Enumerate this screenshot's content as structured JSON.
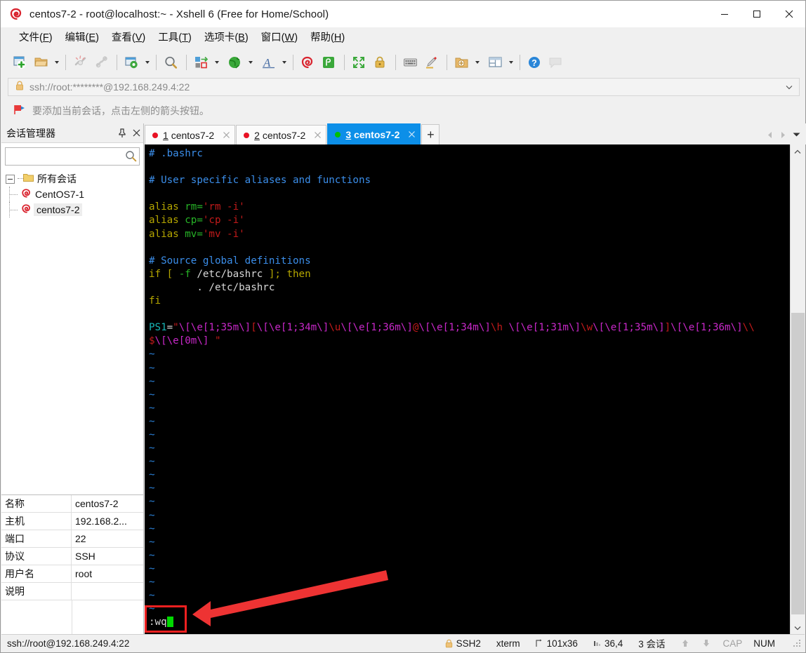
{
  "window": {
    "title": "centos7-2 - root@localhost:~ - Xshell 6 (Free for Home/School)",
    "app_icon": "xshell-logo-icon",
    "minimize_label": "—",
    "maximize_label": "☐",
    "close_label": "✕"
  },
  "menubar": {
    "items": [
      {
        "name": "file",
        "text": "文件",
        "accel": "F"
      },
      {
        "name": "edit",
        "text": "编辑",
        "accel": "E"
      },
      {
        "name": "view",
        "text": "查看",
        "accel": "V"
      },
      {
        "name": "tools",
        "text": "工具",
        "accel": "T"
      },
      {
        "name": "tabs",
        "text": "选项卡",
        "accel": "B"
      },
      {
        "name": "window",
        "text": "窗口",
        "accel": "W"
      },
      {
        "name": "help",
        "text": "帮助",
        "accel": "H"
      }
    ]
  },
  "toolbar": {
    "icons": [
      "new-session-icon",
      "open-folder-icon",
      "disconnect-icon",
      "connect-icon",
      "session-properties-icon",
      "find-icon",
      "transfer-file-icon",
      "web-browser-icon",
      "font-icon",
      "xshell-icon",
      "xftp-icon",
      "fullscreen-icon",
      "lock-icon",
      "keyboard-icon",
      "highlight-icon",
      "add-folder-icon",
      "layout-icon",
      "help-icon",
      "chat-icon"
    ]
  },
  "address_bar": {
    "lock_icon": "lock-icon",
    "value": "ssh://root:********@192.168.249.4:22",
    "placeholder": "ssh://root:********@192.168.249.4:22",
    "dropdown_icon": "chevron-down-icon"
  },
  "notice_bar": {
    "icon": "red-flag-icon",
    "text": "要添加当前会话，点击左侧的箭头按钮。"
  },
  "session_manager": {
    "title": "会话管理器",
    "pin_icon": "pin-icon",
    "close_icon": "close-icon",
    "search": {
      "value": "",
      "placeholder": "",
      "icon": "search-icon"
    },
    "tree": {
      "root": {
        "label": "所有会话",
        "icon": "folder-icon",
        "expanded": true
      },
      "children": [
        {
          "label": "CentOS7-1",
          "icon": "session-icon",
          "selected": false
        },
        {
          "label": "centos7-2",
          "icon": "session-icon",
          "selected": true
        }
      ]
    },
    "properties": {
      "rows": [
        {
          "key": "名称",
          "value": "centos7-2"
        },
        {
          "key": "主机",
          "value": "192.168.2..."
        },
        {
          "key": "端口",
          "value": "22"
        },
        {
          "key": "协议",
          "value": "SSH"
        },
        {
          "key": "用户名",
          "value": "root"
        },
        {
          "key": "说明",
          "value": ""
        }
      ]
    }
  },
  "tabs": {
    "items": [
      {
        "index": "1",
        "label": "centos7-2",
        "status_color": "#e81123",
        "active": false,
        "close_icon": "close-icon"
      },
      {
        "index": "2",
        "label": "centos7-2",
        "status_color": "#e81123",
        "active": false,
        "close_icon": "close-icon"
      },
      {
        "index": "3",
        "label": "centos7-2",
        "status_color": "#00c000",
        "active": true,
        "close_icon": "close-icon"
      }
    ],
    "add_label": "+",
    "prev_icon": "chevron-left-icon",
    "next_icon": "chevron-right-icon",
    "list_icon": "chevron-down-icon",
    "active_color": "#0c8fe8"
  },
  "terminal": {
    "background": "#000000",
    "lines": [
      [
        {
          "t": "# .bashrc",
          "c": "comment"
        }
      ],
      [],
      [
        {
          "t": "# User specific aliases and functions",
          "c": "comment"
        }
      ],
      [],
      [
        {
          "t": "alias ",
          "c": "kw"
        },
        {
          "t": "rm=",
          "c": "green"
        },
        {
          "t": "'rm -i'",
          "c": "red"
        }
      ],
      [
        {
          "t": "alias ",
          "c": "kw"
        },
        {
          "t": "cp=",
          "c": "green"
        },
        {
          "t": "'cp -i'",
          "c": "red"
        }
      ],
      [
        {
          "t": "alias ",
          "c": "kw"
        },
        {
          "t": "mv=",
          "c": "green"
        },
        {
          "t": "'mv -i'",
          "c": "red"
        }
      ],
      [],
      [
        {
          "t": "# Source global definitions",
          "c": "comment"
        }
      ],
      [
        {
          "t": "if ",
          "c": "kw"
        },
        {
          "t": "[ ",
          "c": "kw"
        },
        {
          "t": "-f ",
          "c": "green"
        },
        {
          "t": "/etc/bashrc ",
          "c": "white"
        },
        {
          "t": "]; ",
          "c": "kw"
        },
        {
          "t": "then",
          "c": "kw"
        }
      ],
      [
        {
          "t": "        . /etc/bashrc",
          "c": "white"
        }
      ],
      [
        {
          "t": "fi",
          "c": "kw"
        }
      ],
      [],
      [
        {
          "t": "PS1",
          "c": "teal"
        },
        {
          "t": "=",
          "c": "white"
        },
        {
          "t": "\"",
          "c": "red"
        },
        {
          "t": "\\[\\e[1;35m\\]",
          "c": "magenta"
        },
        {
          "t": "[",
          "c": "red"
        },
        {
          "t": "\\[\\e[1;34m\\]",
          "c": "magenta"
        },
        {
          "t": "\\u",
          "c": "red"
        },
        {
          "t": "\\[\\e[1;36m\\]",
          "c": "magenta"
        },
        {
          "t": "@",
          "c": "red"
        },
        {
          "t": "\\[\\e[1;34m\\]",
          "c": "magenta"
        },
        {
          "t": "\\h ",
          "c": "red"
        },
        {
          "t": "\\[\\e[1;31m\\]",
          "c": "magenta"
        },
        {
          "t": "\\w",
          "c": "red"
        },
        {
          "t": "\\[\\e[1;35m\\]",
          "c": "magenta"
        },
        {
          "t": "]",
          "c": "red"
        },
        {
          "t": "\\[\\e[1;36m\\]",
          "c": "magenta"
        },
        {
          "t": "\\\\",
          "c": "red"
        }
      ],
      [
        {
          "t": "$",
          "c": "red"
        },
        {
          "t": "\\[\\e[0m\\]",
          "c": "magenta"
        },
        {
          "t": " \"",
          "c": "red"
        }
      ]
    ],
    "tilde_count": 20,
    "tilde_char": "~",
    "command_line": ":wq",
    "cursor": "block-cursor"
  },
  "annotation": {
    "box_color": "#ee2020",
    "arrow_color": "#ee3333",
    "target": ":wq"
  },
  "status_bar": {
    "connection": "ssh://root@192.168.249.4:22",
    "items": [
      {
        "name": "security",
        "icon": "lock-icon",
        "text": "SSH2",
        "dim": false
      },
      {
        "name": "terminal-type",
        "icon": "",
        "text": "xterm",
        "dim": false
      },
      {
        "name": "size",
        "icon": "resize-icon",
        "text": "101x36",
        "dim": false
      },
      {
        "name": "cursor-pos",
        "icon": "cursor-icon",
        "text": "36,4",
        "dim": false
      },
      {
        "name": "sessions",
        "icon": "",
        "text": "3 会话",
        "dim": false
      }
    ],
    "transfer_up_icon": "arrow-up-icon",
    "transfer_down_icon": "arrow-down-icon",
    "caps": "CAP",
    "num": "NUM"
  }
}
